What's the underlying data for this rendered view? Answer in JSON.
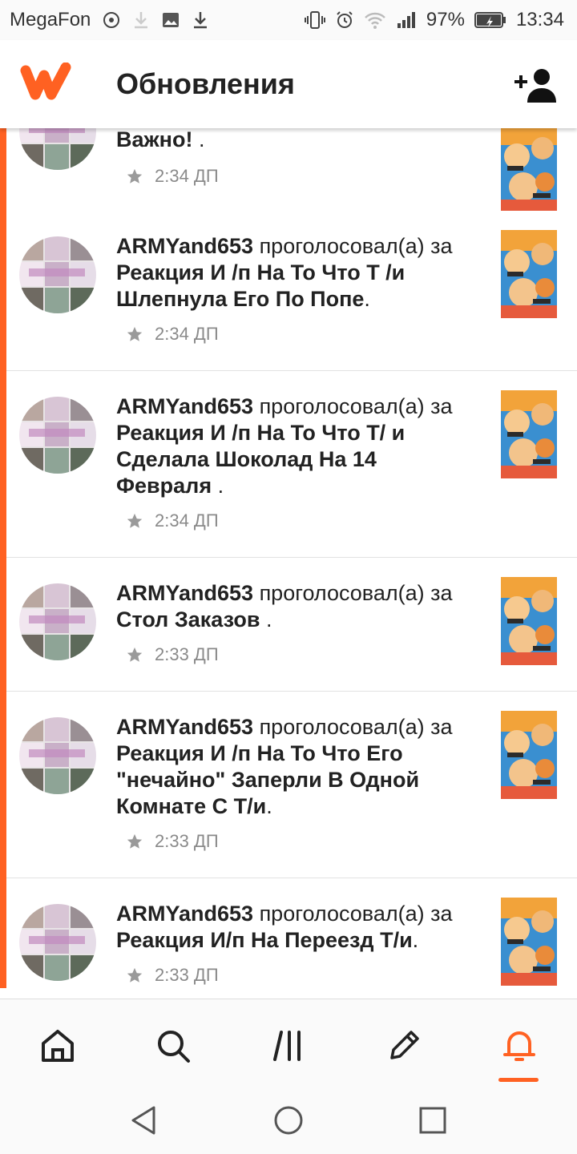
{
  "status_bar": {
    "carrier": "MegaFon",
    "battery": "97%",
    "time": "13:34"
  },
  "header": {
    "title": "Обновления"
  },
  "colors": {
    "accent": "#ff6122"
  },
  "icons": {
    "logo": "wattpad-logo",
    "add_user": "add-user-icon",
    "star": "star-icon"
  },
  "feed": [
    {
      "user": "",
      "action": "",
      "story_pre": "",
      "story": "Важно!",
      "suffix": " .",
      "time": "2:34 ДП"
    },
    {
      "user": "ARMYand653",
      "action": " проголосовал(а) за ",
      "story": "Реакция И /п На То Что Т /и Шлепнула Его По Попе",
      "suffix": ".",
      "time": "2:34 ДП"
    },
    {
      "user": "ARMYand653",
      "action": " проголосовал(а) за ",
      "story": "Реакция И /п На То Что Т/ и Сделала Шоколад На 14 Февраля",
      "suffix": " .",
      "time": "2:34 ДП"
    },
    {
      "user": "ARMYand653",
      "action": " проголосовал(а) за ",
      "story": "Стол Заказов",
      "suffix": " .",
      "time": "2:33 ДП"
    },
    {
      "user": "ARMYand653",
      "action": " проголосовал(а) за ",
      "story": "Реакция И /п На То Что Его \"нечайно\" Заперли В Одной Комнате С Т/и",
      "suffix": ".",
      "time": "2:33 ДП"
    },
    {
      "user": "ARMYand653",
      "action": " проголосовал(а) за ",
      "story": "Реакция И/п На Переезд Т/и",
      "suffix": ".",
      "time": "2:33 ДП"
    }
  ],
  "bottom_nav": {
    "items": [
      "home-icon",
      "search-icon",
      "library-icon",
      "write-icon",
      "notifications-icon"
    ],
    "active": "notifications-icon"
  },
  "system_nav": [
    "back-icon",
    "home-circle-icon",
    "recents-icon"
  ]
}
